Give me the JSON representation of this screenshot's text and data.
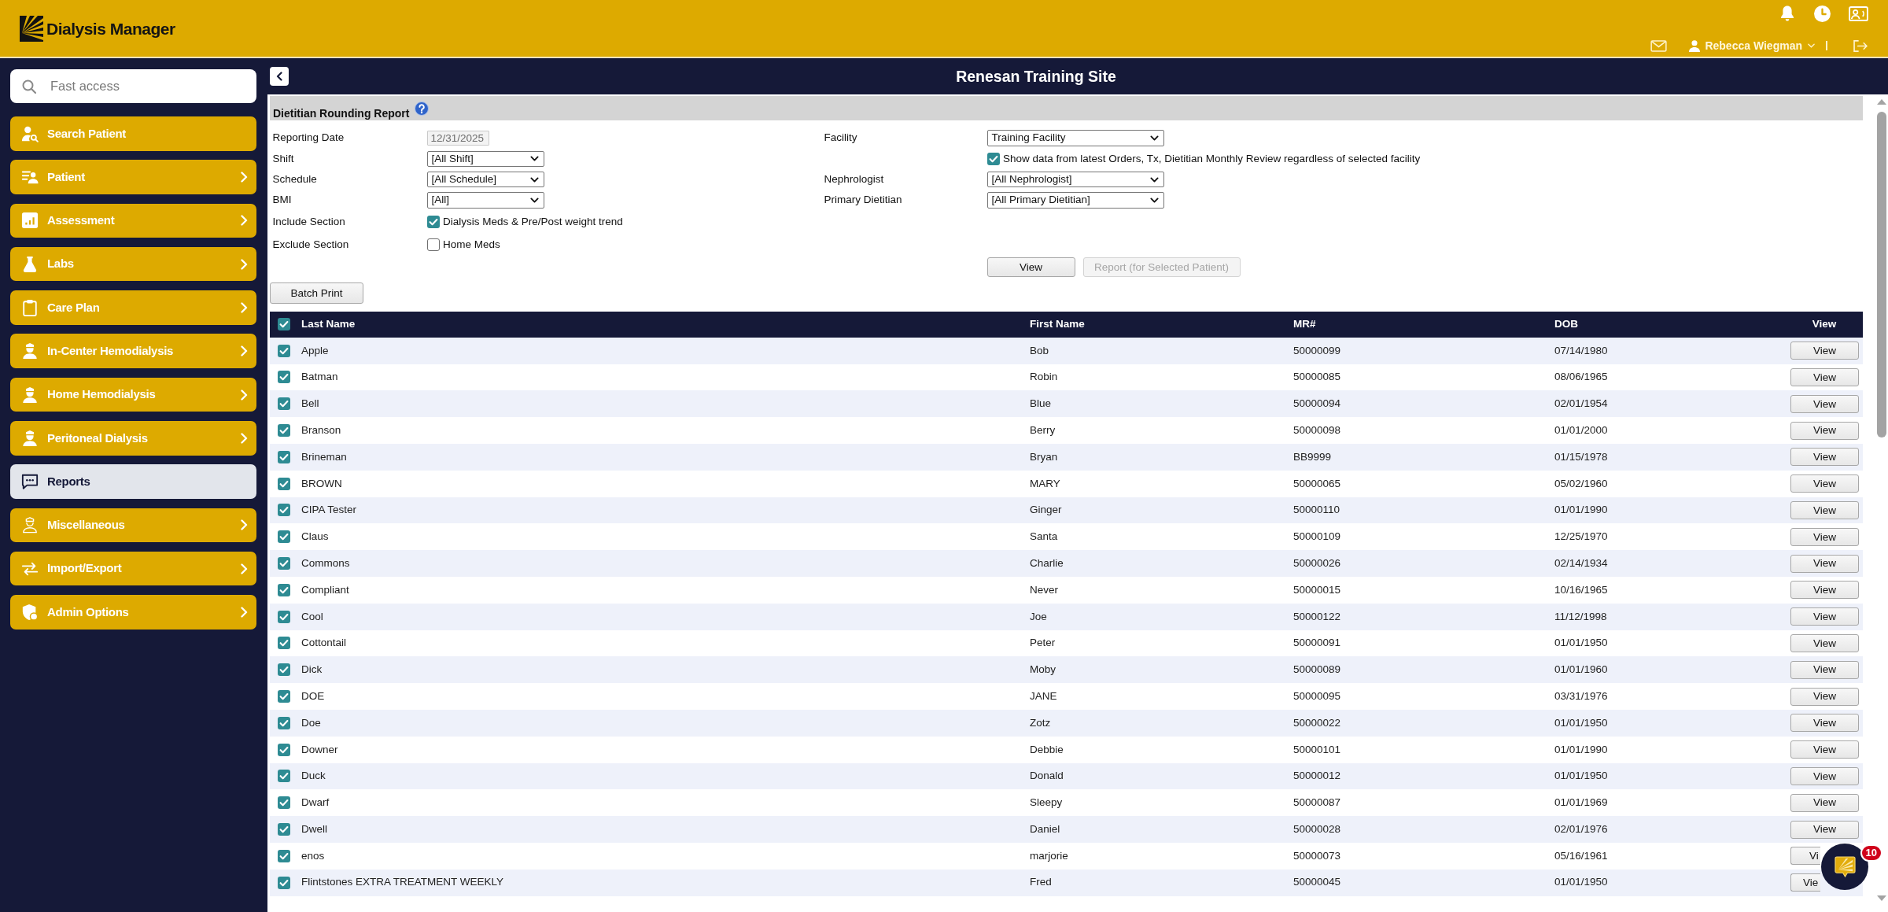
{
  "header": {
    "app_name": "Dialysis Manager",
    "user_name": "Rebecca Wiegman"
  },
  "sidebar": {
    "search": {
      "placeholder": "Fast access"
    },
    "items": [
      {
        "label": "Search Patient",
        "submenu": false,
        "selected": false
      },
      {
        "label": "Patient",
        "submenu": true,
        "selected": false
      },
      {
        "label": "Assessment",
        "submenu": true,
        "selected": false
      },
      {
        "label": "Labs",
        "submenu": true,
        "selected": false
      },
      {
        "label": "Care Plan",
        "submenu": true,
        "selected": false
      },
      {
        "label": "In-Center Hemodialysis",
        "submenu": true,
        "selected": false
      },
      {
        "label": "Home Hemodialysis",
        "submenu": true,
        "selected": false
      },
      {
        "label": "Peritoneal Dialysis",
        "submenu": true,
        "selected": false
      },
      {
        "label": "Reports",
        "submenu": false,
        "selected": true
      },
      {
        "label": "Miscellaneous",
        "submenu": true,
        "selected": false
      },
      {
        "label": "Import/Export",
        "submenu": true,
        "selected": false
      },
      {
        "label": "Admin Options",
        "submenu": true,
        "selected": false
      }
    ]
  },
  "page": {
    "site_title": "Renesan Training Site"
  },
  "report": {
    "title": "Dietitian Rounding Report",
    "left_fields": [
      {
        "label": "Reporting Date",
        "kind": "date",
        "value": "12/31/2025",
        "disabled": true
      },
      {
        "label": "Shift",
        "kind": "select",
        "value": "[All Shift]"
      },
      {
        "label": "Schedule",
        "kind": "select",
        "value": "[All Schedule]"
      },
      {
        "label": "BMI",
        "kind": "select",
        "value": "[All]"
      },
      {
        "label": "Include Section",
        "kind": "checkbox",
        "text": "Dialysis Meds & Pre/Post weight trend",
        "checked": true
      },
      {
        "label": "Exclude Section",
        "kind": "checkbox",
        "text": "Home Meds",
        "checked": false
      }
    ],
    "right_fields": [
      {
        "label": "Facility",
        "kind": "select",
        "value": "Training Facility"
      },
      {
        "kind": "checkbox",
        "text": "Show data from latest Orders, Tx, Dietitian Monthly Review regardless of selected facility",
        "checked": true
      },
      {
        "label": "Nephrologist",
        "kind": "select",
        "value": "[All Nephrologist]"
      },
      {
        "label": "Primary Dietitian",
        "kind": "select",
        "value": "[All Primary Dietitian]"
      }
    ],
    "actions": [
      {
        "label": "View",
        "disabled": false
      },
      {
        "label": "Report (for Selected Patient)",
        "disabled": true
      }
    ],
    "batch_print": {
      "label": "Batch Print"
    }
  },
  "table": {
    "select_all": {
      "checked": true
    },
    "columns": [
      "Last Name",
      "First Name",
      "MR#",
      "DOB",
      "View"
    ],
    "rows": [
      {
        "checked": true,
        "last_name": "Apple",
        "first_name": "Bob",
        "mr": "50000099",
        "dob": "07/14/1980",
        "button": "View"
      },
      {
        "checked": true,
        "last_name": "Batman",
        "first_name": "Robin",
        "mr": "50000085",
        "dob": "08/06/1965",
        "button": "View"
      },
      {
        "checked": true,
        "last_name": "Bell",
        "first_name": "Blue",
        "mr": "50000094",
        "dob": "02/01/1954",
        "button": "View"
      },
      {
        "checked": true,
        "last_name": "Branson",
        "first_name": "Berry",
        "mr": "50000098",
        "dob": "01/01/2000",
        "button": "View"
      },
      {
        "checked": true,
        "last_name": "Brineman",
        "first_name": "Bryan",
        "mr": "BB9999",
        "dob": "01/15/1978",
        "button": "View"
      },
      {
        "checked": true,
        "last_name": "BROWN",
        "first_name": "MARY",
        "mr": "50000065",
        "dob": "05/02/1960",
        "button": "View"
      },
      {
        "checked": true,
        "last_name": "CIPA Tester",
        "first_name": "Ginger",
        "mr": "50000110",
        "dob": "01/01/1990",
        "button": "View"
      },
      {
        "checked": true,
        "last_name": "Claus",
        "first_name": "Santa",
        "mr": "50000109",
        "dob": "12/25/1970",
        "button": "View"
      },
      {
        "checked": true,
        "last_name": "Commons",
        "first_name": "Charlie",
        "mr": "50000026",
        "dob": "02/14/1934",
        "button": "View"
      },
      {
        "checked": true,
        "last_name": "Compliant",
        "first_name": "Never",
        "mr": "50000015",
        "dob": "10/16/1965",
        "button": "View"
      },
      {
        "checked": true,
        "last_name": "Cool",
        "first_name": "Joe",
        "mr": "50000122",
        "dob": "11/12/1998",
        "button": "View"
      },
      {
        "checked": true,
        "last_name": "Cottontail",
        "first_name": "Peter",
        "mr": "50000091",
        "dob": "01/01/1950",
        "button": "View"
      },
      {
        "checked": true,
        "last_name": "Dick",
        "first_name": "Moby",
        "mr": "50000089",
        "dob": "01/01/1960",
        "button": "View"
      },
      {
        "checked": true,
        "last_name": "DOE",
        "first_name": "JANE",
        "mr": "50000095",
        "dob": "03/31/1976",
        "button": "View"
      },
      {
        "checked": true,
        "last_name": "Doe",
        "first_name": "Zotz",
        "mr": "50000022",
        "dob": "01/01/1950",
        "button": "View"
      },
      {
        "checked": true,
        "last_name": "Downer",
        "first_name": "Debbie",
        "mr": "50000101",
        "dob": "01/01/1990",
        "button": "View"
      },
      {
        "checked": true,
        "last_name": "Duck",
        "first_name": "Donald",
        "mr": "50000012",
        "dob": "01/01/1950",
        "button": "View"
      },
      {
        "checked": true,
        "last_name": "Dwarf",
        "first_name": "Sleepy",
        "mr": "50000087",
        "dob": "01/01/1969",
        "button": "View"
      },
      {
        "checked": true,
        "last_name": "Dwell",
        "first_name": "Daniel",
        "mr": "50000028",
        "dob": "02/01/1976",
        "button": "View"
      },
      {
        "checked": true,
        "last_name": "enos",
        "first_name": "marjorie",
        "mr": "50000073",
        "dob": "05/16/1961",
        "button": "Vi"
      },
      {
        "checked": true,
        "last_name": "Flintstones EXTRA TREATMENT WEEKLY",
        "first_name": "Fred",
        "mr": "50000045",
        "dob": "01/01/1950",
        "button": "Vie"
      }
    ]
  },
  "chat": {
    "badge": "10"
  }
}
